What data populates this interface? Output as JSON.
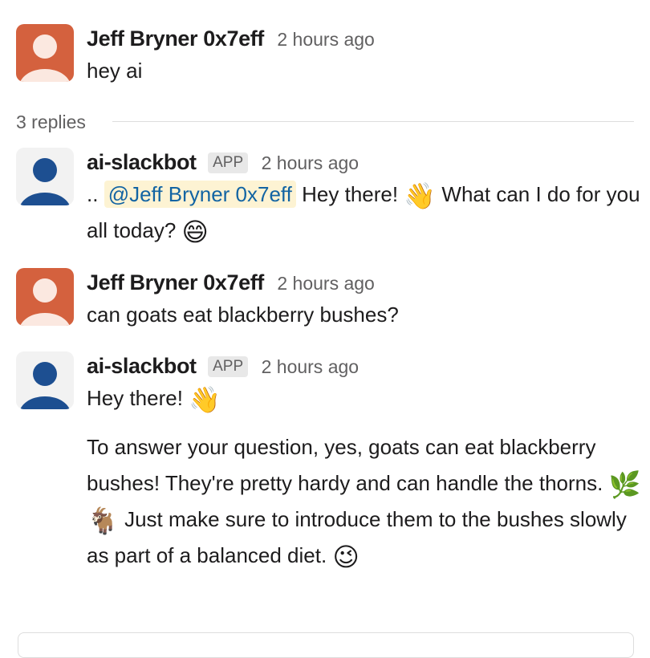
{
  "thread": {
    "replies_label": "3 replies"
  },
  "messages": [
    {
      "author": "Jeff Bryner 0x7eff",
      "timestamp": "2 hours ago",
      "text": "hey ai",
      "avatar_color": "#d4613e"
    },
    {
      "author": "ai-slackbot",
      "badge": "APP",
      "timestamp": "2 hours ago",
      "prefix": "..",
      "mention": "@Jeff Bryner 0x7eff",
      "text_a": "Hey there!",
      "emoji_a": "👋",
      "text_b": "What can I do for you all today?",
      "emoji_b": "😄",
      "avatar_color": "#1d4f91"
    },
    {
      "author": "Jeff Bryner 0x7eff",
      "timestamp": "2 hours ago",
      "text": "can goats eat blackberry bushes?",
      "avatar_color": "#d4613e"
    },
    {
      "author": "ai-slackbot",
      "badge": "APP",
      "timestamp": "2 hours ago",
      "p1_text": "Hey there!",
      "p1_emoji": "👋",
      "p2_text_a": "To answer your question, yes, goats can eat blackberry bushes! They're pretty hardy and can handle the thorns.",
      "p2_emoji_a": "🌿",
      "p2_emoji_b": "🐐",
      "p2_text_b": "Just make sure to introduce them to the bushes slowly as part of a balanced diet.",
      "p2_emoji_c": "😉",
      "avatar_color": "#1d4f91"
    }
  ],
  "colors": {
    "mention_text": "#1264a3",
    "mention_bg": "#fdf3d3",
    "secondary_text": "#616061"
  }
}
